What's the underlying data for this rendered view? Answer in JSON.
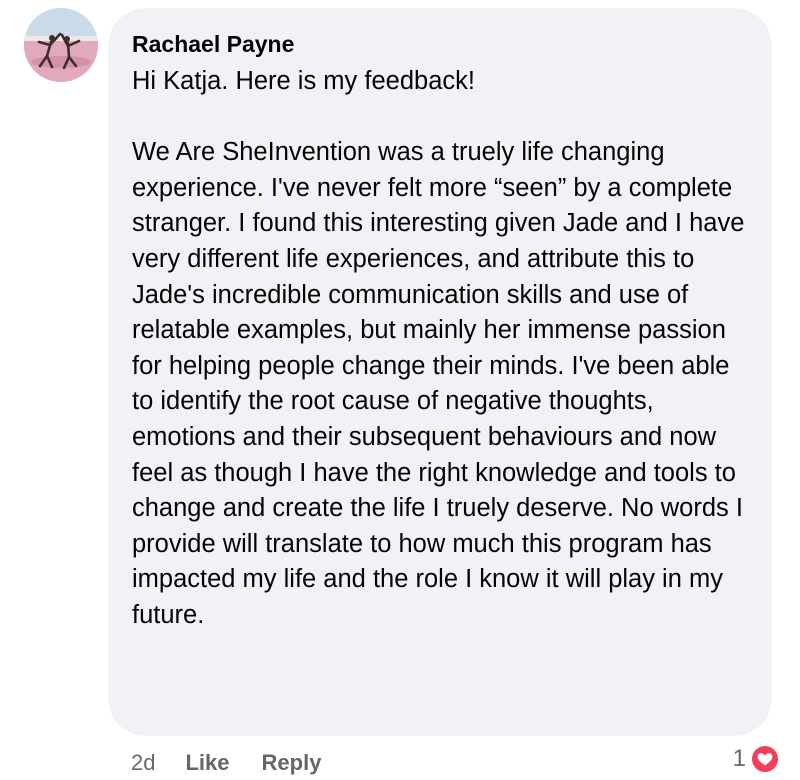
{
  "comment": {
    "author": "Rachael Payne",
    "greeting": "Hi Katja. Here is my feedback!",
    "body": "We Are SheInvention was a truely life changing experience. I've never felt more “seen” by a complete stranger. I found this interesting given Jade and I have very different life experiences, and attribute this to Jade's incredible communication skills and use of relatable examples, but mainly her immense passion for helping people change their minds. I've been able to identify the root cause of negative thoughts, emotions and their subsequent behaviours and now feel as though I have the right knowledge and tools to change and create the life I truely deserve. No words I provide will translate to how much this program has impacted my life and the role I know it will play in my future.",
    "timestamp": "2d",
    "like_label": "Like",
    "reply_label": "Reply",
    "reaction_count": "1",
    "reaction_icon": "heart-icon",
    "reaction_color": "#f33e58"
  }
}
